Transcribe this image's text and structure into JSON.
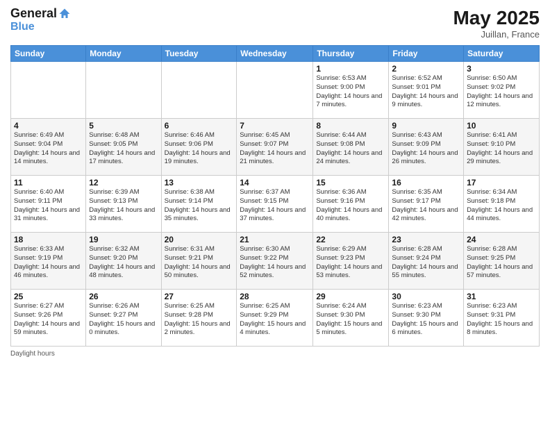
{
  "logo": {
    "line1": "General",
    "line2": "Blue"
  },
  "title": {
    "month_year": "May 2025",
    "location": "Juillan, France"
  },
  "days_of_week": [
    "Sunday",
    "Monday",
    "Tuesday",
    "Wednesday",
    "Thursday",
    "Friday",
    "Saturday"
  ],
  "weeks": [
    [
      {
        "day": "",
        "info": ""
      },
      {
        "day": "",
        "info": ""
      },
      {
        "day": "",
        "info": ""
      },
      {
        "day": "",
        "info": ""
      },
      {
        "day": "1",
        "info": "Sunrise: 6:53 AM\nSunset: 9:00 PM\nDaylight: 14 hours and 7 minutes."
      },
      {
        "day": "2",
        "info": "Sunrise: 6:52 AM\nSunset: 9:01 PM\nDaylight: 14 hours and 9 minutes."
      },
      {
        "day": "3",
        "info": "Sunrise: 6:50 AM\nSunset: 9:02 PM\nDaylight: 14 hours and 12 minutes."
      }
    ],
    [
      {
        "day": "4",
        "info": "Sunrise: 6:49 AM\nSunset: 9:04 PM\nDaylight: 14 hours and 14 minutes."
      },
      {
        "day": "5",
        "info": "Sunrise: 6:48 AM\nSunset: 9:05 PM\nDaylight: 14 hours and 17 minutes."
      },
      {
        "day": "6",
        "info": "Sunrise: 6:46 AM\nSunset: 9:06 PM\nDaylight: 14 hours and 19 minutes."
      },
      {
        "day": "7",
        "info": "Sunrise: 6:45 AM\nSunset: 9:07 PM\nDaylight: 14 hours and 21 minutes."
      },
      {
        "day": "8",
        "info": "Sunrise: 6:44 AM\nSunset: 9:08 PM\nDaylight: 14 hours and 24 minutes."
      },
      {
        "day": "9",
        "info": "Sunrise: 6:43 AM\nSunset: 9:09 PM\nDaylight: 14 hours and 26 minutes."
      },
      {
        "day": "10",
        "info": "Sunrise: 6:41 AM\nSunset: 9:10 PM\nDaylight: 14 hours and 29 minutes."
      }
    ],
    [
      {
        "day": "11",
        "info": "Sunrise: 6:40 AM\nSunset: 9:11 PM\nDaylight: 14 hours and 31 minutes."
      },
      {
        "day": "12",
        "info": "Sunrise: 6:39 AM\nSunset: 9:13 PM\nDaylight: 14 hours and 33 minutes."
      },
      {
        "day": "13",
        "info": "Sunrise: 6:38 AM\nSunset: 9:14 PM\nDaylight: 14 hours and 35 minutes."
      },
      {
        "day": "14",
        "info": "Sunrise: 6:37 AM\nSunset: 9:15 PM\nDaylight: 14 hours and 37 minutes."
      },
      {
        "day": "15",
        "info": "Sunrise: 6:36 AM\nSunset: 9:16 PM\nDaylight: 14 hours and 40 minutes."
      },
      {
        "day": "16",
        "info": "Sunrise: 6:35 AM\nSunset: 9:17 PM\nDaylight: 14 hours and 42 minutes."
      },
      {
        "day": "17",
        "info": "Sunrise: 6:34 AM\nSunset: 9:18 PM\nDaylight: 14 hours and 44 minutes."
      }
    ],
    [
      {
        "day": "18",
        "info": "Sunrise: 6:33 AM\nSunset: 9:19 PM\nDaylight: 14 hours and 46 minutes."
      },
      {
        "day": "19",
        "info": "Sunrise: 6:32 AM\nSunset: 9:20 PM\nDaylight: 14 hours and 48 minutes."
      },
      {
        "day": "20",
        "info": "Sunrise: 6:31 AM\nSunset: 9:21 PM\nDaylight: 14 hours and 50 minutes."
      },
      {
        "day": "21",
        "info": "Sunrise: 6:30 AM\nSunset: 9:22 PM\nDaylight: 14 hours and 52 minutes."
      },
      {
        "day": "22",
        "info": "Sunrise: 6:29 AM\nSunset: 9:23 PM\nDaylight: 14 hours and 53 minutes."
      },
      {
        "day": "23",
        "info": "Sunrise: 6:28 AM\nSunset: 9:24 PM\nDaylight: 14 hours and 55 minutes."
      },
      {
        "day": "24",
        "info": "Sunrise: 6:28 AM\nSunset: 9:25 PM\nDaylight: 14 hours and 57 minutes."
      }
    ],
    [
      {
        "day": "25",
        "info": "Sunrise: 6:27 AM\nSunset: 9:26 PM\nDaylight: 14 hours and 59 minutes."
      },
      {
        "day": "26",
        "info": "Sunrise: 6:26 AM\nSunset: 9:27 PM\nDaylight: 15 hours and 0 minutes."
      },
      {
        "day": "27",
        "info": "Sunrise: 6:25 AM\nSunset: 9:28 PM\nDaylight: 15 hours and 2 minutes."
      },
      {
        "day": "28",
        "info": "Sunrise: 6:25 AM\nSunset: 9:29 PM\nDaylight: 15 hours and 4 minutes."
      },
      {
        "day": "29",
        "info": "Sunrise: 6:24 AM\nSunset: 9:30 PM\nDaylight: 15 hours and 5 minutes."
      },
      {
        "day": "30",
        "info": "Sunrise: 6:23 AM\nSunset: 9:30 PM\nDaylight: 15 hours and 6 minutes."
      },
      {
        "day": "31",
        "info": "Sunrise: 6:23 AM\nSunset: 9:31 PM\nDaylight: 15 hours and 8 minutes."
      }
    ]
  ],
  "legend": {
    "label": "Daylight hours"
  }
}
